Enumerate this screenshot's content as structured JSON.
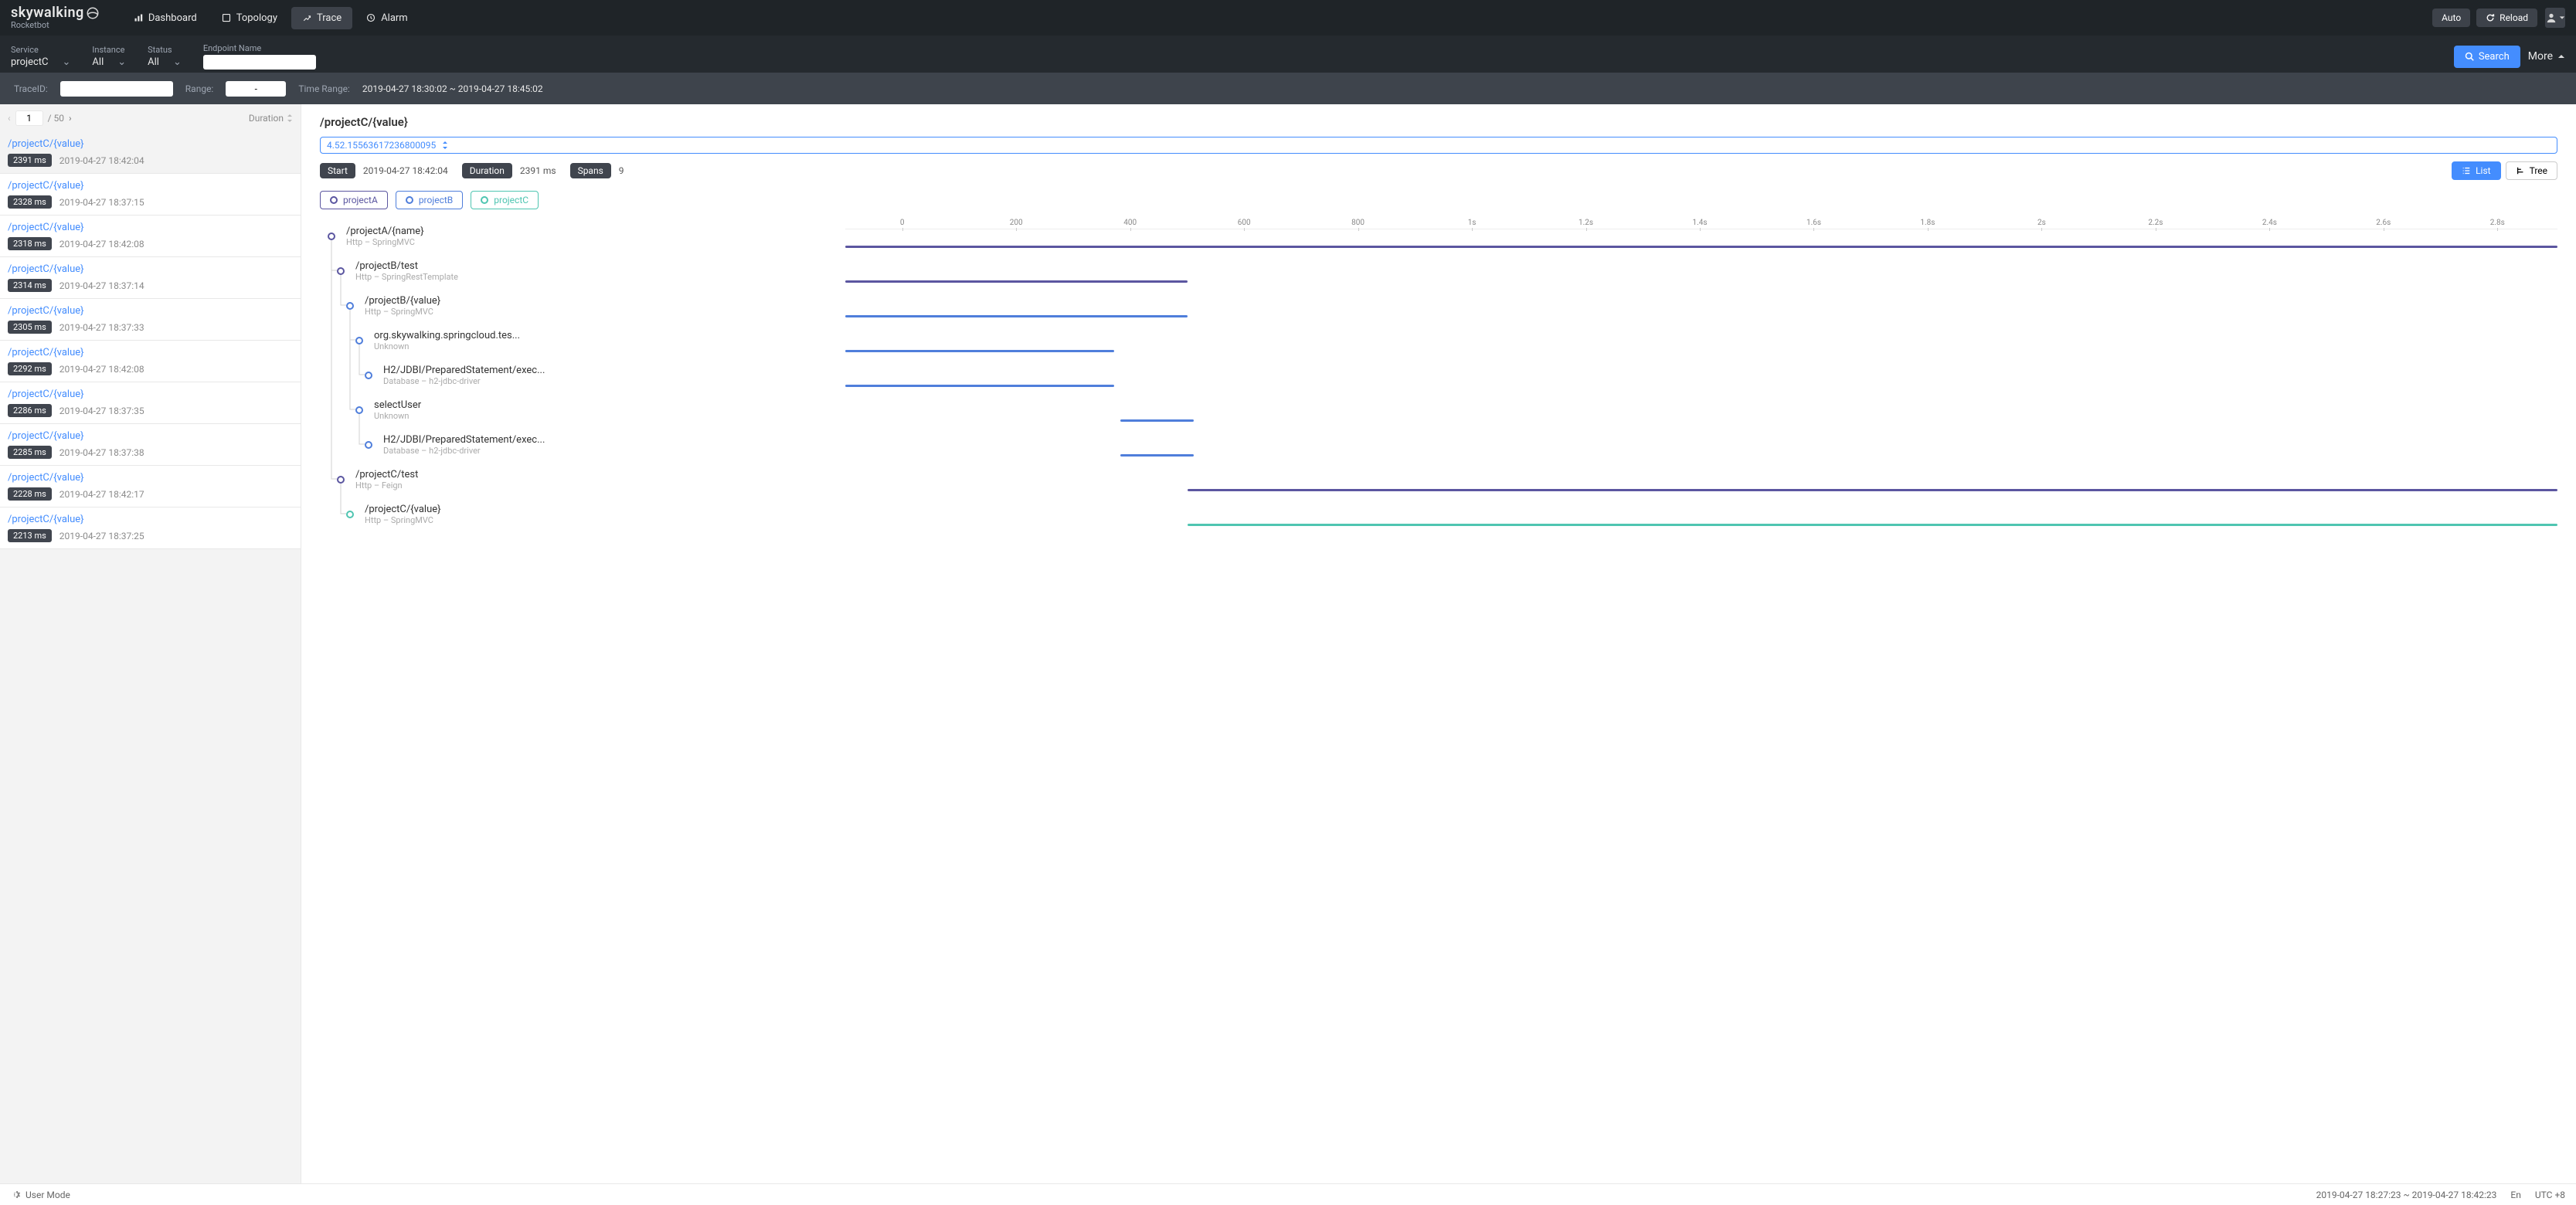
{
  "brand": {
    "name": "skywalking",
    "sub": "Rocketbot"
  },
  "nav": {
    "dashboard": "Dashboard",
    "topology": "Topology",
    "trace": "Trace",
    "alarm": "Alarm",
    "auto": "Auto",
    "reload": "Reload"
  },
  "filters": {
    "service": {
      "label": "Service",
      "value": "projectC"
    },
    "instance": {
      "label": "Instance",
      "value": "All"
    },
    "status": {
      "label": "Status",
      "value": "All"
    },
    "endpoint": {
      "label": "Endpoint Name",
      "value": ""
    },
    "search": "Search",
    "more": "More"
  },
  "tracebar": {
    "traceid_label": "TraceID:",
    "traceid_value": "",
    "range_label": "Range:",
    "range_value": "-",
    "timerange_label": "Time Range:",
    "timerange_value": "2019-04-27 18:30:02 ~ 2019-04-27 18:45:02"
  },
  "pager": {
    "page": "1",
    "total": "/  50",
    "sort_label": "Duration"
  },
  "traces": [
    {
      "endpoint": "/projectC/{value}",
      "duration": "2391 ms",
      "time": "2019-04-27 18:42:04"
    },
    {
      "endpoint": "/projectC/{value}",
      "duration": "2328 ms",
      "time": "2019-04-27 18:37:15"
    },
    {
      "endpoint": "/projectC/{value}",
      "duration": "2318 ms",
      "time": "2019-04-27 18:42:08"
    },
    {
      "endpoint": "/projectC/{value}",
      "duration": "2314 ms",
      "time": "2019-04-27 18:37:14"
    },
    {
      "endpoint": "/projectC/{value}",
      "duration": "2305 ms",
      "time": "2019-04-27 18:37:33"
    },
    {
      "endpoint": "/projectC/{value}",
      "duration": "2292 ms",
      "time": "2019-04-27 18:42:08"
    },
    {
      "endpoint": "/projectC/{value}",
      "duration": "2286 ms",
      "time": "2019-04-27 18:37:35"
    },
    {
      "endpoint": "/projectC/{value}",
      "duration": "2285 ms",
      "time": "2019-04-27 18:37:38"
    },
    {
      "endpoint": "/projectC/{value}",
      "duration": "2228 ms",
      "time": "2019-04-27 18:42:17"
    },
    {
      "endpoint": "/projectC/{value}",
      "duration": "2213 ms",
      "time": "2019-04-27 18:37:25"
    }
  ],
  "detail": {
    "title": "/projectC/{value}",
    "trace_id": "4.52.15563617236800095",
    "start_label": "Start",
    "start_value": "2019-04-27 18:42:04",
    "duration_label": "Duration",
    "duration_value": "2391 ms",
    "spans_label": "Spans",
    "spans_value": "9",
    "list_btn": "List",
    "tree_btn": "Tree"
  },
  "legend": {
    "projectA": "projectA",
    "projectB": "projectB",
    "projectC": "projectC"
  },
  "chart_data": {
    "type": "gantt",
    "x_ticks": [
      "0",
      "200",
      "400",
      "600",
      "800",
      "1s",
      "1.2s",
      "1.4s",
      "1.6s",
      "1.8s",
      "2s",
      "2.2s",
      "2.4s",
      "2.6s",
      "2.8s"
    ],
    "x_max_ms": 2800,
    "spans": [
      {
        "name": "/projectA/{name}",
        "sub": "Http  –  SpringMVC",
        "service": "projectA",
        "depth": 0,
        "start_ms": 0,
        "duration_ms": 2800,
        "color": "#5b56a0"
      },
      {
        "name": "/projectB/test",
        "sub": "Http  –  SpringRestTemplate",
        "service": "projectA",
        "depth": 1,
        "start_ms": 0,
        "duration_ms": 560,
        "color": "#5b56a0"
      },
      {
        "name": "/projectB/{value}",
        "sub": "Http  –  SpringMVC",
        "service": "projectB",
        "depth": 2,
        "start_ms": 0,
        "duration_ms": 560,
        "color": "#4f7edb"
      },
      {
        "name": "org.skywalking.springcloud.tes...",
        "sub": "Unknown",
        "service": "projectB",
        "depth": 3,
        "start_ms": 0,
        "duration_ms": 440,
        "color": "#4f7edb"
      },
      {
        "name": "H2/JDBI/PreparedStatement/exec...",
        "sub": "Database  –  h2-jdbc-driver",
        "service": "projectB",
        "depth": 4,
        "start_ms": 0,
        "duration_ms": 440,
        "color": "#4f7edb"
      },
      {
        "name": "selectUser",
        "sub": "Unknown",
        "service": "projectB",
        "depth": 3,
        "start_ms": 450,
        "duration_ms": 120,
        "color": "#4f7edb"
      },
      {
        "name": "H2/JDBI/PreparedStatement/exec...",
        "sub": "Database  –  h2-jdbc-driver",
        "service": "projectB",
        "depth": 4,
        "start_ms": 450,
        "duration_ms": 120,
        "color": "#4f7edb"
      },
      {
        "name": "/projectC/test",
        "sub": "Http  –  Feign",
        "service": "projectA",
        "depth": 1,
        "start_ms": 560,
        "duration_ms": 2240,
        "color": "#5b56a0"
      },
      {
        "name": "/projectC/{value}",
        "sub": "Http  –  SpringMVC",
        "service": "projectC",
        "depth": 2,
        "start_ms": 560,
        "duration_ms": 2240,
        "color": "#4fc5b1"
      }
    ]
  },
  "footer": {
    "user_mode": "User Mode",
    "timerange": "2019-04-27 18:27:23 ~ 2019-04-27 18:42:23",
    "lang": "En",
    "tz": "UTC +8"
  }
}
